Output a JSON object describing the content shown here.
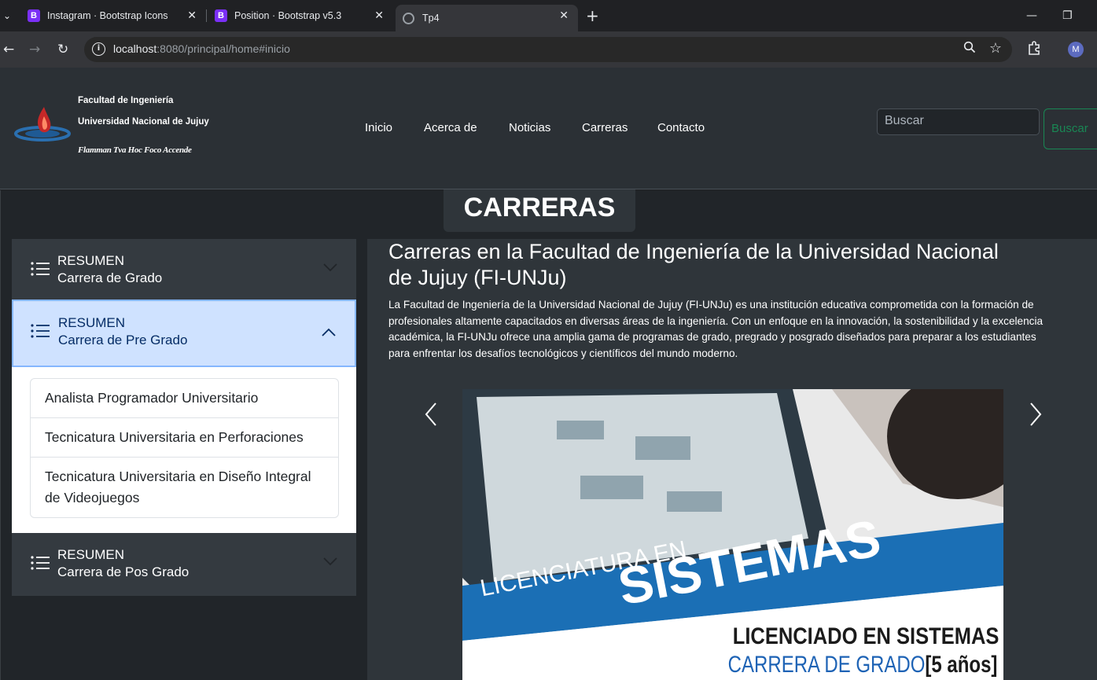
{
  "browser": {
    "tabs": [
      {
        "favicon": "B",
        "title": "Instagram · Bootstrap Icons"
      },
      {
        "favicon": "B",
        "title": "Position · Bootstrap v5.3"
      },
      {
        "favicon": "globe-icon",
        "title": "Tp4"
      }
    ],
    "url_host": "localhost",
    "url_rest": ":8080/principal/home#inicio",
    "profile_initial": "M"
  },
  "header": {
    "brand_line1": "Facultad de Ingeniería",
    "brand_line2": "Universidad Nacional de Jujuy",
    "motto": "Flamman Tva Hoc Foco Accende",
    "nav": [
      "Inicio",
      "Acerca de",
      "Noticias",
      "Carreras",
      "Contacto"
    ],
    "search_placeholder": "Buscar",
    "search_button": "Buscar"
  },
  "section": {
    "title": "CARRERAS"
  },
  "accordion": [
    {
      "line1": "RESUMEN",
      "line2": "Carrera de Grado",
      "open": false
    },
    {
      "line1": "RESUMEN",
      "line2": "Carrera de Pre Grado",
      "open": true,
      "items": [
        "Analista Programador Universitario",
        "Tecnicatura Universitaria en Perforaciones",
        "Tecnicatura Universitaria en Diseño Integral de Videojuegos"
      ]
    },
    {
      "line1": "RESUMEN",
      "line2": "Carrera de Pos Grado",
      "open": false
    }
  ],
  "content": {
    "heading": "Carreras en la Facultad de Ingeniería de la Universidad Nacional de Jujuy (FI-UNJu)",
    "paragraph": "La Facultad de Ingeniería de la Universidad Nacional de Jujuy (FI-UNJu) es una institución educativa comprometida con la formación de profesionales altamente capacitados en diversas áreas de la ingeniería. Con un enfoque en la innovación, la sostenibilidad y la excelencia académica, la FI-UNJu ofrece una amplia gama de programas de grado, pregrado y posgrado diseñados para preparar a los estudiantes para enfrentar los desafíos tecnológicos y científicos del mundo moderno."
  },
  "carousel": {
    "caption_small": "LICENCIATURA EN",
    "caption_big": "SISTEMAS",
    "caption_title": "LICENCIADO EN SISTEMAS",
    "caption_sub": "CARRERA DE GRADO",
    "caption_years": "[5 años]"
  }
}
